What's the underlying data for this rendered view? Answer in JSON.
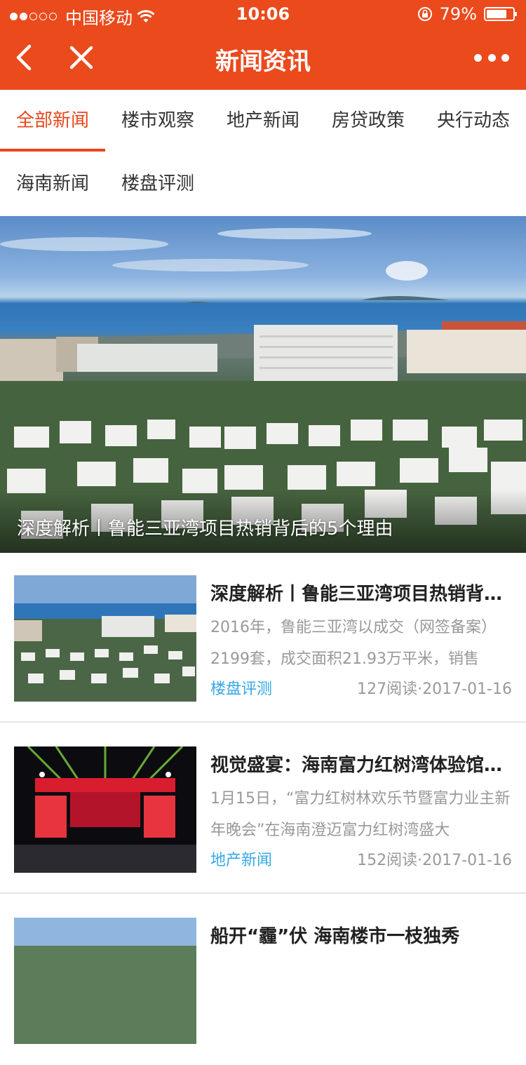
{
  "status": {
    "carrier": "中国移动",
    "time": "10:06",
    "battery": "79%",
    "battery_level": 0.79
  },
  "nav": {
    "title": "新闻资讯"
  },
  "tabs": [
    {
      "label": "全部新闻",
      "active": true
    },
    {
      "label": "楼市观察"
    },
    {
      "label": "地产新闻"
    },
    {
      "label": "房贷政策"
    },
    {
      "label": "央行动态"
    },
    {
      "label": "海南新闻"
    },
    {
      "label": "楼盘评测"
    }
  ],
  "hero": {
    "caption": "深度解析丨鲁能三亚湾项目热销背后的5个理由"
  },
  "articles": [
    {
      "title": "深度解析丨鲁能三亚湾项目热销背后的5个理由",
      "desc": "2016年，鲁能三亚湾以成交（网签备案）2199套，成交面积21.93万平米，销售",
      "category": "楼盘评测",
      "meta": "127阅读·2017-01-16"
    },
    {
      "title": "视觉盛宴：海南富力红树湾体验馆盛大开放",
      "desc": "1月15日，“富力红树林欢乐节暨富力业主新年晚会”在海南澄迈富力红树湾盛大",
      "category": "地产新闻",
      "meta": "152阅读·2017-01-16"
    },
    {
      "title": "船开“霾”伏 海南楼市一枝独秀",
      "desc": "",
      "category": "",
      "meta": ""
    }
  ],
  "colors": {
    "brand": "#ea4a1c",
    "active_tab": "#e8471b",
    "category": "#36a7e6"
  }
}
